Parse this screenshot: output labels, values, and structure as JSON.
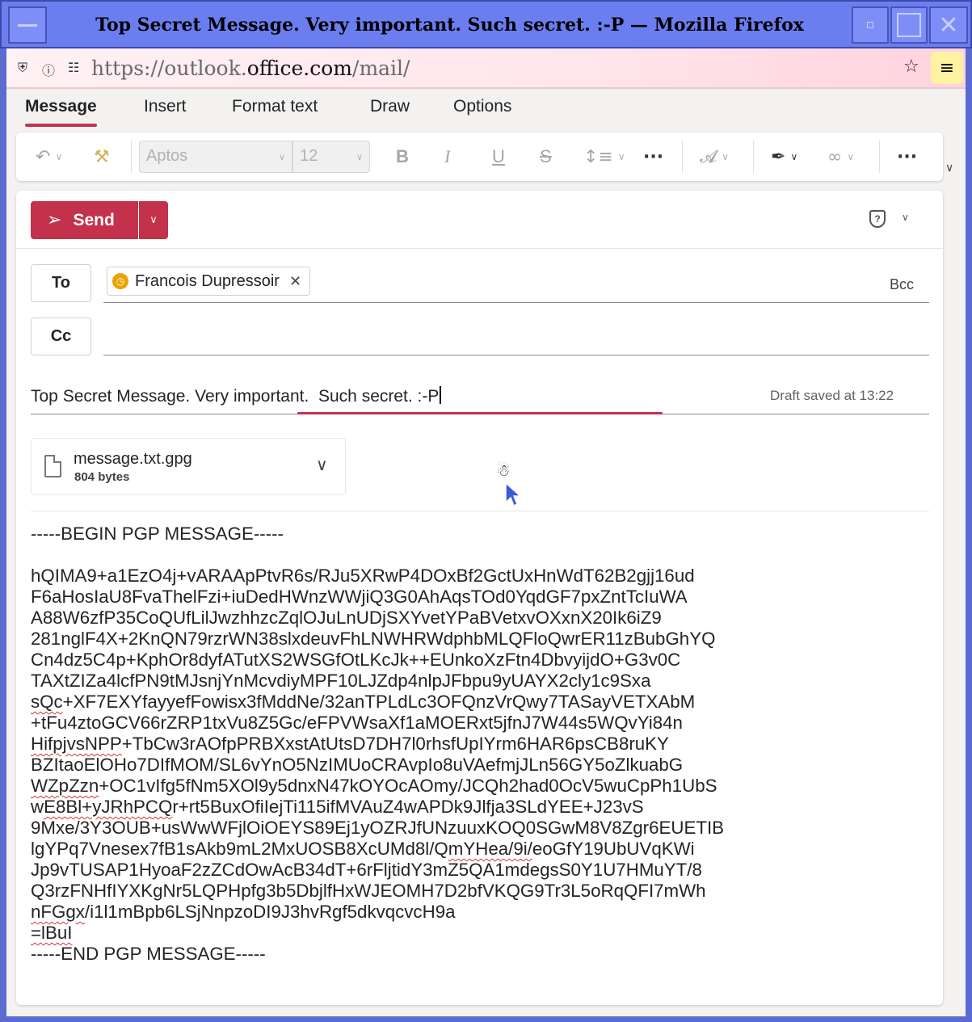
{
  "window": {
    "title": "Top Secret Message. Very important. Such secret. :-P — Mozilla Firefox",
    "close_glyph": "✕"
  },
  "browser": {
    "url_prefix": "https://outlook.",
    "url_domain": "office.com",
    "url_suffix": "/mail/",
    "icons": [
      "shield-icon",
      "info-icon",
      "permissions-icon",
      "bookmark-star-icon",
      "hamburger-menu-icon"
    ]
  },
  "ribbon": {
    "tabs": [
      "Message",
      "Insert",
      "Format text",
      "Draw",
      "Options"
    ],
    "active_tab": "Message",
    "font_name": "Aptos",
    "font_size": "12",
    "bold": "B",
    "italic": "I",
    "underline": "U",
    "strike": "S",
    "more": "···"
  },
  "compose": {
    "send_label": "Send",
    "to_label": "To",
    "cc_label": "Cc",
    "bcc_label": "Bcc",
    "recipient": "Francois Dupressoir",
    "subject": "Top Secret Message. Very important.  Such secret. :-P",
    "draft_status": "Draft saved at 13:22",
    "attachment": {
      "name": "message.txt.gpg",
      "size": "804 bytes"
    }
  },
  "message_body": [
    "-----BEGIN PGP MESSAGE-----",
    "",
    "hQIMA9+a1EzO4j+vARAApPtvR6s/RJu5XRwP4DOxBf2GctUxHnWdT62B2gjj16ud",
    "F6aHosIaU8FvaThelFzi+iuDedHWnzWWjiQ3G0AhAqsTOd0YqdGF7pxZntTcIuWA",
    "A88W6zfP35CoQUfLilJwzhhzcZqlOJuLnUDjSXYvetYPaBVetxvOXxnX20Ik6iZ9",
    "281nglF4X+2KnQN79rzrWN38slxdeuvFhLNWHRWdphbMLQFloQwrER11zBubGhYQ",
    "Cn4dz5C4p+KphOr8dyfATutXS2WSGfOtLKcJk++EUnkoXzFtn4DbvyijdO+G3v0C",
    "TAXtZIZa4lcfPN9tMJsnjYnMcvdiyMPF10LJZdp4nlpJFbpu9yUAYX2cly1c9Sxa",
    "sQc+XF7EXYfayyefFowisx3fMddNe/32anTPLdLc3OFQnzVrQwy7TASayVETXAbM",
    "+tFu4ztoGCV66rZRP1txVu8Z5Gc/eFPVWsaXf1aMOERxt5jfnJ7W44s5WQvYi84n",
    "HifpjvsNPP+TbCw3rAOfpPRBXxstAtUtsD7DH7l0rhsfUpIYrm6HAR6psCB8ruKY",
    "BZItaoElOHo7DIfMOM/SL6vYnO5NzIMUoCRAvpIo8uVAefmjJLn56GY5oZlkuabG",
    "WZpZzn+OC1vIfg5fNm5XOl9y5dnxN47kOYOcAOmy/JCQh2had0OcV5wuCpPh1UbS",
    "wE8Bl+yJRhPCQr+rt5BuxOfiIejTi115ifMVAuZ4wAPDk9Jlfja3SLdYEE+J23vS",
    "9Mxe/3Y3OUB+usWwWFjlOiOEYS89Ej1yOZRJfUNzuuxKOQ0SGwM8V8Zgr6EUETIB",
    "lgYPq7Vnesex7fB1sAkb9mL2MxUOSB8XcUMd8l/QmYHea/9i/eoGfY19UbUVqKWi",
    "Jp9vTUSAP1HyoaF2zZCdOwAcB34dT+6rFljtidY3mZ5QA1mdegsS0Y1U7HMuYT/8",
    "Q3rzFNHfIYXKgNr5LQPHpfg3b5DbjlfHxWJEOMH7D2bfVKQG9Tr3L5oRqQFI7mWh",
    "nFGgx/i1l1mBpb6LSjNnpzoDI9J3hvRgf5dkvqcvcH9a",
    "=lBuI",
    "-----END PGP MESSAGE-----"
  ]
}
